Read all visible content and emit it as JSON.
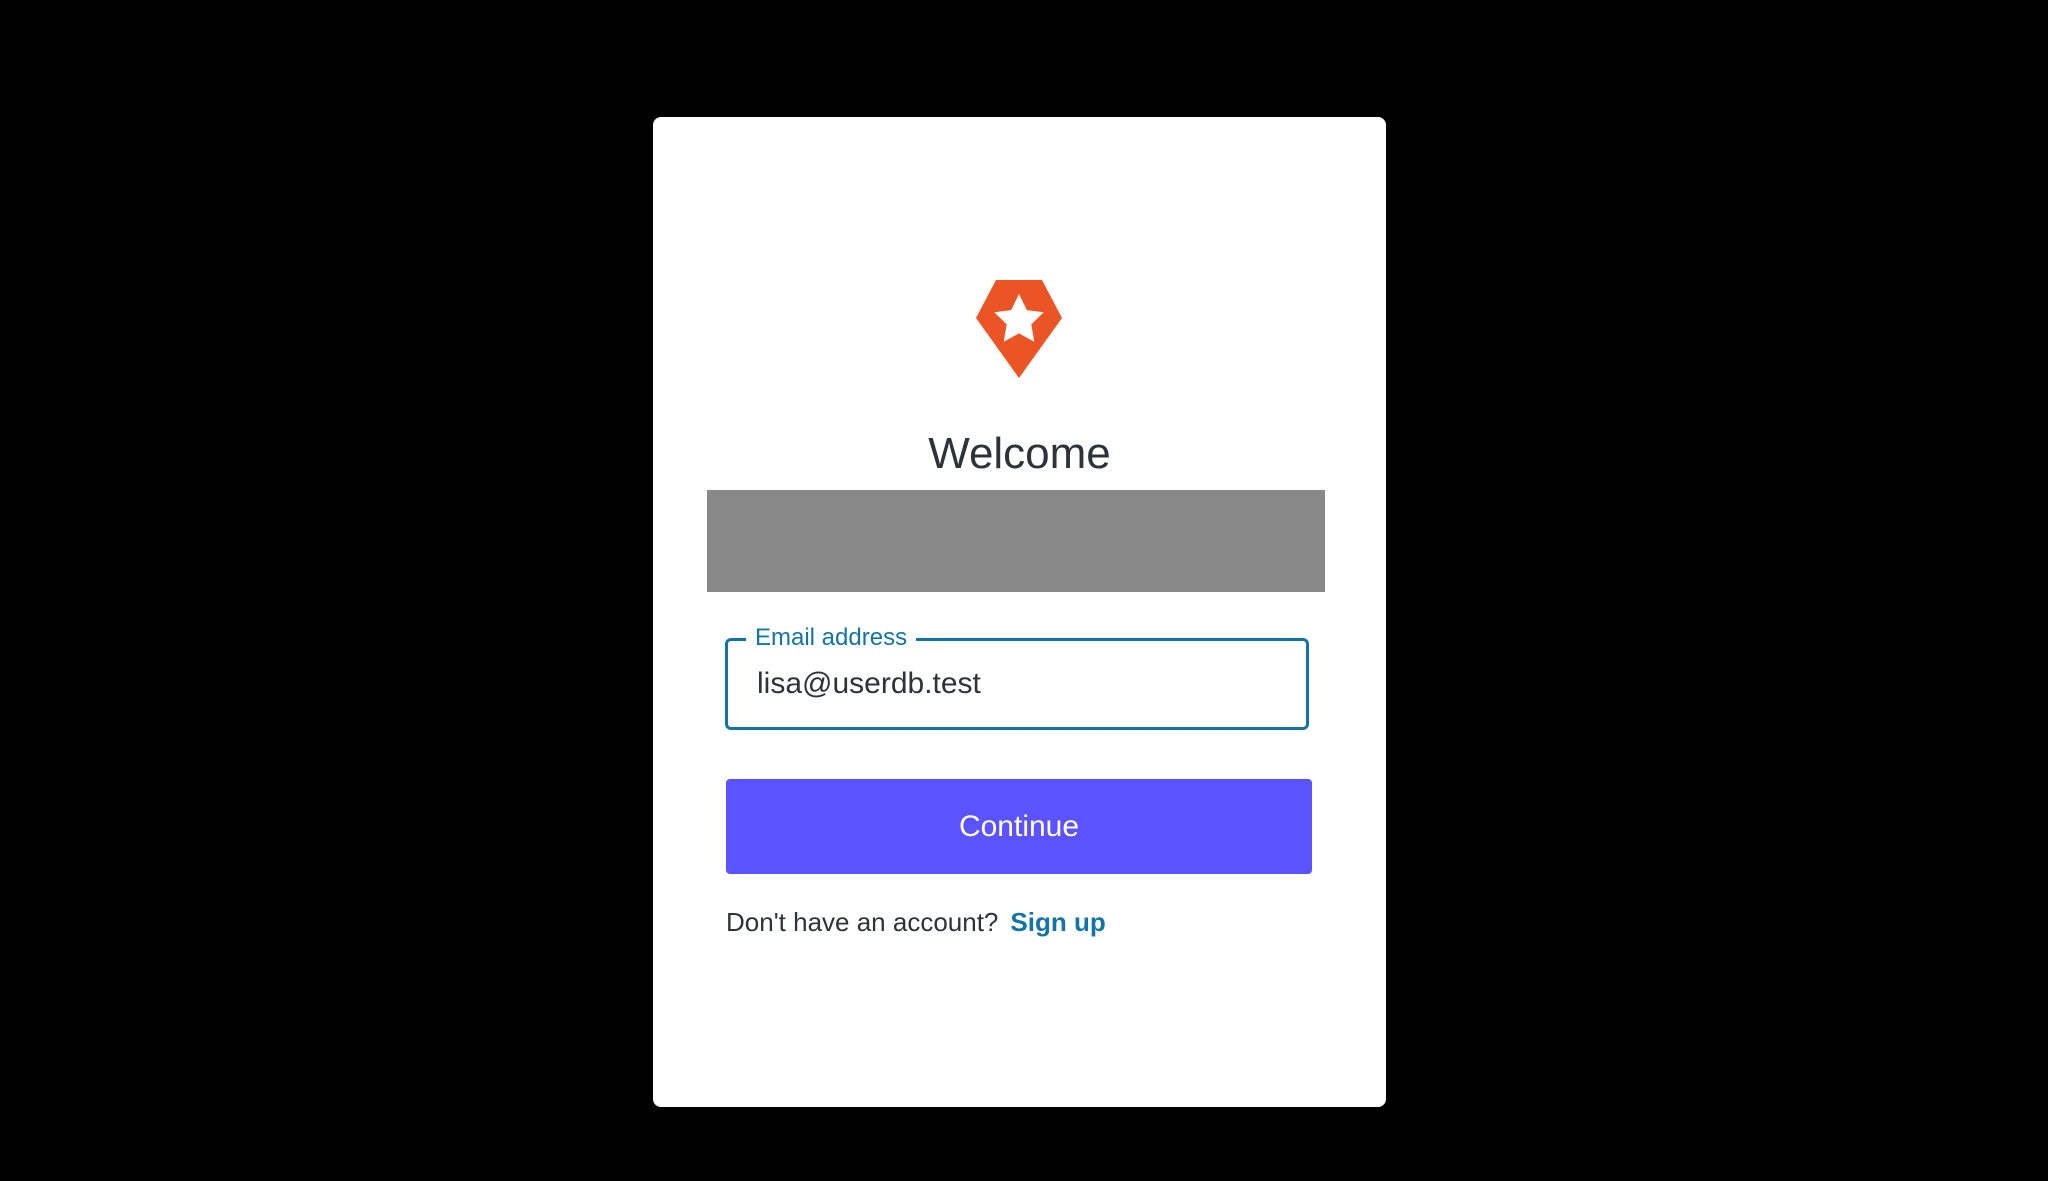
{
  "login": {
    "logo_icon": "auth-shield-star-icon",
    "brand_color": "#eb5424",
    "title": "Welcome",
    "email": {
      "label": "Email address",
      "value": "lisa@userdb.test"
    },
    "continue_label": "Continue",
    "signup_prompt": "Don't have an account?",
    "signup_link": "Sign up",
    "accent_color": "#5b53ff",
    "link_color": "#1474a8"
  }
}
